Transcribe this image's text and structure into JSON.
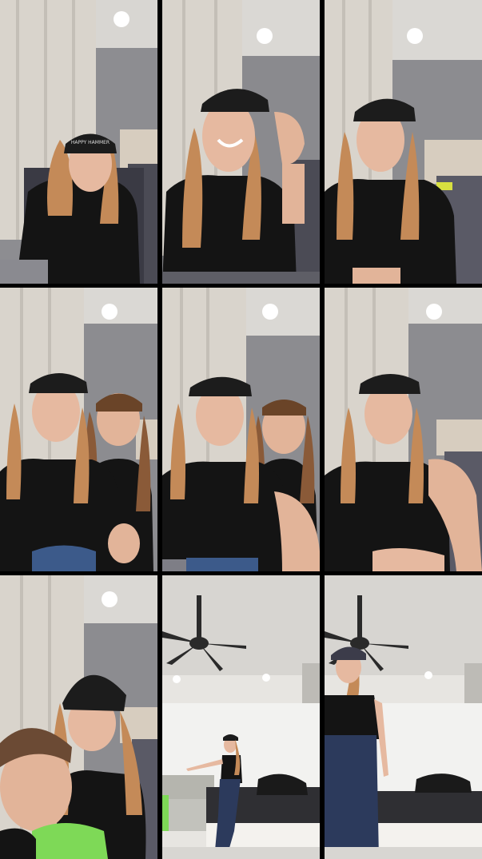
{
  "collage": {
    "rows": 3,
    "columns": 3,
    "background_color": "#000000",
    "frames": [
      {
        "scene": "bedroom",
        "people": 1,
        "caption": ""
      },
      {
        "scene": "bedroom",
        "people": 1,
        "caption": ""
      },
      {
        "scene": "bedroom",
        "people": 1,
        "caption": ""
      },
      {
        "scene": "bedroom",
        "people": 2,
        "caption": ""
      },
      {
        "scene": "bedroom",
        "people": 2,
        "caption": ""
      },
      {
        "scene": "bedroom",
        "people": 1,
        "caption": ""
      },
      {
        "scene": "bedroom",
        "people": 2,
        "caption": ""
      },
      {
        "scene": "living-room",
        "people": 1,
        "caption": ""
      },
      {
        "scene": "living-room",
        "people": 1,
        "caption": ""
      }
    ]
  },
  "colors": {
    "wall": "#8f8f93",
    "curtain": "#d9d4cc",
    "ceiling": "#dcdad6",
    "shirt": "#141414",
    "hair": "#c48a58",
    "cap": "#1c1c1c",
    "skin": "#e6b9a0"
  },
  "cap_text": "HAPPY HAMMER"
}
